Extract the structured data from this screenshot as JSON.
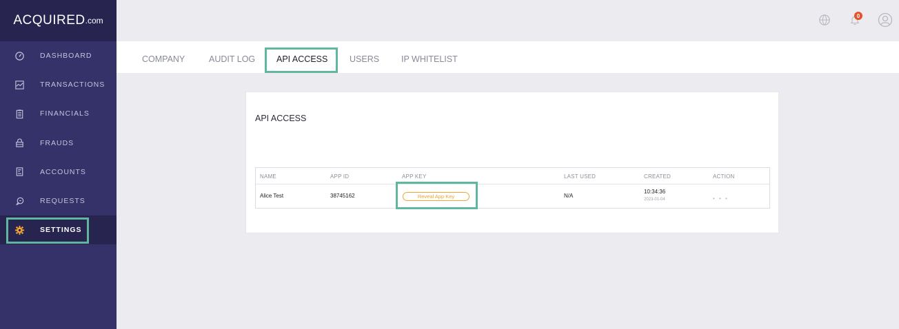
{
  "brand": {
    "name": "ACQUIRED",
    "suffix": ".com"
  },
  "sidebar": {
    "items": [
      {
        "label": "DASHBOARD",
        "icon": "dashboard-icon"
      },
      {
        "label": "TRANSACTIONS",
        "icon": "chart-icon"
      },
      {
        "label": "FINANCIALS",
        "icon": "clipboard-icon"
      },
      {
        "label": "FRAUDS",
        "icon": "lock-icon"
      },
      {
        "label": "ACCOUNTS",
        "icon": "document-icon"
      },
      {
        "label": "REQUESTS",
        "icon": "chat-icon"
      },
      {
        "label": "SETTINGS",
        "icon": "gear-icon",
        "active": true
      }
    ]
  },
  "header": {
    "notification_count": "0",
    "icons": [
      "globe-icon",
      "bell-icon",
      "user-icon"
    ]
  },
  "tabs": [
    {
      "label": "COMPANY"
    },
    {
      "label": "AUDIT LOG"
    },
    {
      "label": "API ACCESS",
      "active": true
    },
    {
      "label": "USERS"
    },
    {
      "label": "IP WHITELIST"
    }
  ],
  "card": {
    "title": "API ACCESS",
    "columns": [
      "NAME",
      "APP ID",
      "APP KEY",
      "LAST USED",
      "CREATED",
      "ACTION"
    ],
    "rows": [
      {
        "name": "Alice Test",
        "app_id": "38745162",
        "app_key_button": "Reveal App Key",
        "last_used": "N/A",
        "created_time": "10:34:36",
        "created_date": "2023-01-04",
        "action": "• • •"
      }
    ]
  },
  "colors": {
    "sidebar": "#35326a",
    "sidebar_dark": "#27254f",
    "highlight": "#5fb79f",
    "accent": "#f0a531",
    "badge": "#e5532d"
  }
}
